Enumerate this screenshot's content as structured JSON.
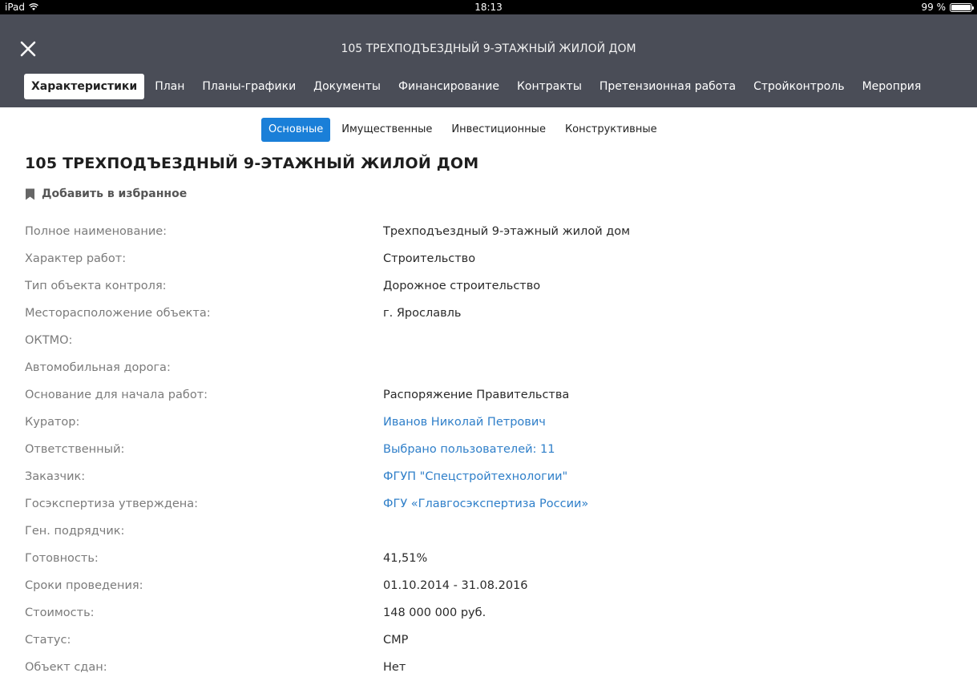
{
  "status_bar": {
    "device": "iPad",
    "time": "18:13",
    "battery": "99 %"
  },
  "header": {
    "title": "105 ТРЕХПОДЪЕЗДНЫЙ 9-ЭТАЖНЫЙ ЖИЛОЙ ДОМ",
    "tabs": [
      {
        "label": "Характеристики",
        "active": true
      },
      {
        "label": "План"
      },
      {
        "label": "Планы-графики"
      },
      {
        "label": "Документы"
      },
      {
        "label": "Финансирование"
      },
      {
        "label": "Контракты"
      },
      {
        "label": "Претензионная работа"
      },
      {
        "label": "Стройконтроль"
      },
      {
        "label": "Мероприя"
      }
    ]
  },
  "subtabs": [
    {
      "label": "Основные",
      "active": true
    },
    {
      "label": "Имущественные"
    },
    {
      "label": "Инвестиционные"
    },
    {
      "label": "Конструктивные"
    }
  ],
  "page_title": "105 ТРЕХПОДЪЕЗДНЫЙ 9-ЭТАЖНЫЙ ЖИЛОЙ ДОМ",
  "favorite_label": "Добавить в избранное",
  "properties": [
    {
      "label": "Полное наименование:",
      "value": "Трехподъездный 9-этажный жилой дом"
    },
    {
      "label": "Характер работ:",
      "value": "Строительство"
    },
    {
      "label": "Тип объекта контроля:",
      "value": "Дорожное строительство"
    },
    {
      "label": "Месторасположение объекта:",
      "value": "г. Ярославль"
    },
    {
      "label": "ОКТМО:",
      "value": ""
    },
    {
      "label": "Автомобильная дорога:",
      "value": ""
    },
    {
      "label": "Основание для начала работ:",
      "value": "Распоряжение Правительства"
    },
    {
      "label": "Куратор:",
      "value": "Иванов Николай Петрович",
      "link": true
    },
    {
      "label": "Ответственный:",
      "value": "Выбрано пользователей: 11",
      "link": true
    },
    {
      "label": "Заказчик:",
      "value": "ФГУП \"Спецстройтехнологии\"",
      "link": true
    },
    {
      "label": "Госэкспертиза утверждена:",
      "value": "ФГУ «Главгосэкспертиза России»",
      "link": true
    },
    {
      "label": "Ген. подрядчик:",
      "value": ""
    },
    {
      "label": "Готовность:",
      "value": "41,51%"
    },
    {
      "label": "Сроки проведения:",
      "value": "01.10.2014 - 31.08.2016"
    },
    {
      "label": "Стоимость:",
      "value": "148 000 000 руб."
    },
    {
      "label": "Статус:",
      "value": "СМР"
    },
    {
      "label": "Объект сдан:",
      "value": "Нет"
    }
  ]
}
